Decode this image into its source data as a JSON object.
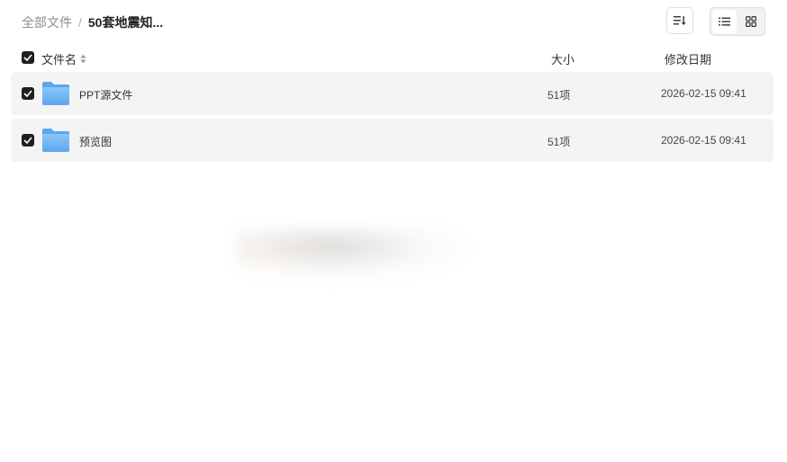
{
  "breadcrumb": {
    "root": "全部文件",
    "separator": "/",
    "current": "50套地震知..."
  },
  "toolbar": {
    "sort_icon": "sort-icon",
    "list_view_icon": "list-view-icon",
    "grid_view_icon": "grid-view-icon"
  },
  "columns": {
    "name": "文件名",
    "size": "大小",
    "date": "修改日期"
  },
  "rows": [
    {
      "name": "PPT源文件",
      "size": "51项",
      "date": "2026-02-15 09:41",
      "checked": true,
      "icon": "folder-icon"
    },
    {
      "name": "预览图",
      "size": "51项",
      "date": "2026-02-15 09:41",
      "checked": true,
      "icon": "folder-icon"
    }
  ],
  "colors": {
    "folder": "#6fb3f2",
    "row_bg": "#f4f4f4",
    "checkbox": "#1f1f1f"
  }
}
